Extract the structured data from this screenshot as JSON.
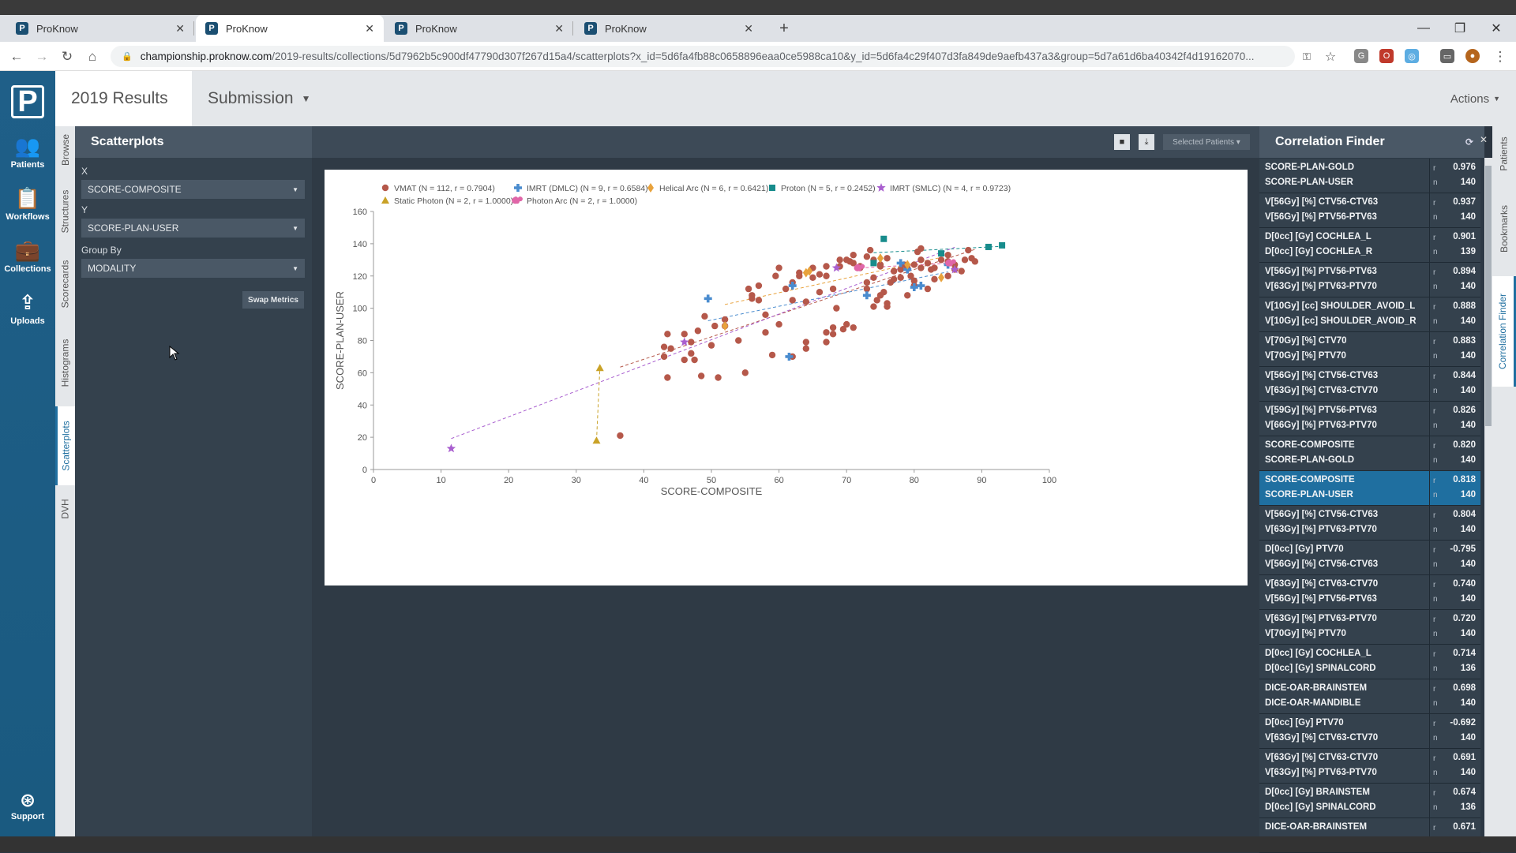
{
  "browser": {
    "tabs": [
      {
        "label": "ProKnow",
        "favicon": "P"
      },
      {
        "label": "ProKnow",
        "favicon": "P"
      },
      {
        "label": "ProKnow",
        "favicon": "P"
      },
      {
        "label": "ProKnow",
        "favicon": "P"
      }
    ],
    "url_host": "championship.proknow.com",
    "url_path": "/2019-results/collections/5d7962b5c900df47790d307f267d15a4/scatterplots?x_id=5d6fa4fb88c0658896eaa0ce5988ca10&y_id=5d6fa4c29f407d3fa849de9aefb437a3&group=5d7a61d6ba40342f4d19162070..."
  },
  "leftnav": {
    "logo": "P",
    "items": [
      {
        "label": "Patients",
        "icon": "users-icon"
      },
      {
        "label": "Workflows",
        "icon": "clipboard-check-icon"
      },
      {
        "label": "Collections",
        "icon": "briefcase-icon"
      },
      {
        "label": "Uploads",
        "icon": "upload-icon"
      }
    ],
    "support": "Support"
  },
  "header": {
    "title": "2019 Results",
    "subtitle": "Submission",
    "actions": "Actions"
  },
  "vtabs": [
    "Browse",
    "Structures",
    "Scorecards",
    "Histograms",
    "Scatterplots",
    "DVH"
  ],
  "panel": {
    "title": "Scatterplots",
    "x_label": "X",
    "x_value": "SCORE-COMPOSITE",
    "y_label": "Y",
    "y_value": "SCORE-PLAN-USER",
    "group_label": "Group By",
    "group_value": "MODALITY",
    "swap": "Swap Metrics"
  },
  "toolbar": {
    "selected_patients": "Selected Patients"
  },
  "chart_data": {
    "type": "scatter",
    "xlabel": "SCORE-COMPOSITE",
    "ylabel": "SCORE-PLAN-USER",
    "xlim": [
      0,
      100
    ],
    "ylim": [
      0,
      160
    ],
    "xticks": [
      0,
      10,
      20,
      30,
      40,
      50,
      60,
      70,
      80,
      90,
      100
    ],
    "yticks": [
      0,
      20,
      40,
      60,
      80,
      100,
      120,
      140,
      160
    ],
    "legend_placement": "top-left",
    "series": [
      {
        "name": "VMAT (N = 112, r = 0.7904)",
        "color": "#b5584a",
        "marker": "circle",
        "points": [
          [
            36.5,
            21
          ],
          [
            43.5,
            57
          ],
          [
            43,
            70
          ],
          [
            43,
            76
          ],
          [
            43.5,
            84
          ],
          [
            44,
            75
          ],
          [
            46,
            84
          ],
          [
            46,
            68
          ],
          [
            47,
            72
          ],
          [
            47,
            79
          ],
          [
            47.5,
            68
          ],
          [
            48,
            86
          ],
          [
            48.5,
            58
          ],
          [
            49,
            95
          ],
          [
            50,
            77
          ],
          [
            50.5,
            89
          ],
          [
            51,
            57
          ],
          [
            52,
            93
          ],
          [
            52,
            89
          ],
          [
            54,
            80
          ],
          [
            55,
            60
          ],
          [
            55.5,
            112
          ],
          [
            56,
            106
          ],
          [
            56,
            108
          ],
          [
            57,
            105
          ],
          [
            57,
            114
          ],
          [
            58,
            85
          ],
          [
            58,
            96
          ],
          [
            59,
            71
          ],
          [
            59.5,
            120
          ],
          [
            60,
            90
          ],
          [
            60,
            125
          ],
          [
            61,
            112
          ],
          [
            62,
            70
          ],
          [
            62,
            105
          ],
          [
            62,
            116
          ],
          [
            63,
            120
          ],
          [
            63,
            122
          ],
          [
            64,
            75
          ],
          [
            64,
            79
          ],
          [
            64,
            104
          ],
          [
            65,
            119
          ],
          [
            65,
            125
          ],
          [
            66,
            110
          ],
          [
            66,
            121
          ],
          [
            67,
            120
          ],
          [
            67,
            126
          ],
          [
            67,
            79
          ],
          [
            67,
            85
          ],
          [
            68,
            84
          ],
          [
            68,
            88
          ],
          [
            68,
            112
          ],
          [
            68.5,
            100
          ],
          [
            69,
            126
          ],
          [
            69,
            130
          ],
          [
            69.5,
            87
          ],
          [
            70,
            90
          ],
          [
            70,
            130
          ],
          [
            70.5,
            129
          ],
          [
            71,
            128
          ],
          [
            71,
            133
          ],
          [
            71,
            88
          ],
          [
            72,
            126
          ],
          [
            72,
            125
          ],
          [
            73,
            132
          ],
          [
            73,
            112
          ],
          [
            73,
            116
          ],
          [
            73.5,
            136
          ],
          [
            74,
            130
          ],
          [
            74,
            119
          ],
          [
            74,
            101
          ],
          [
            74.5,
            105
          ],
          [
            75,
            127
          ],
          [
            75,
            126
          ],
          [
            75,
            108
          ],
          [
            75.5,
            110
          ],
          [
            76,
            101
          ],
          [
            76,
            103
          ],
          [
            76,
            131
          ],
          [
            76.5,
            116
          ],
          [
            77,
            118
          ],
          [
            77,
            123
          ],
          [
            78,
            119
          ],
          [
            78,
            124
          ],
          [
            78.5,
            127
          ],
          [
            79,
            108
          ],
          [
            79,
            125
          ],
          [
            79.5,
            120
          ],
          [
            80,
            114
          ],
          [
            80,
            117
          ],
          [
            80,
            127
          ],
          [
            80.5,
            135
          ],
          [
            81,
            137
          ],
          [
            81,
            125
          ],
          [
            81,
            130
          ],
          [
            82,
            128
          ],
          [
            82,
            112
          ],
          [
            82.5,
            124
          ],
          [
            83,
            118
          ],
          [
            83,
            125
          ],
          [
            84,
            130
          ],
          [
            85,
            120
          ],
          [
            85,
            129
          ],
          [
            85,
            133
          ],
          [
            86,
            124
          ],
          [
            86,
            127
          ],
          [
            87,
            123
          ],
          [
            87.5,
            130
          ],
          [
            88,
            136
          ],
          [
            88.5,
            131
          ],
          [
            89,
            129
          ]
        ]
      },
      {
        "name": "IMRT (DMLC) (N = 9, r = 0.6584)",
        "color": "#4a8ccf",
        "marker": "plus",
        "points": [
          [
            49.5,
            106
          ],
          [
            61.5,
            70
          ],
          [
            62,
            114
          ],
          [
            73,
            108
          ],
          [
            78,
            128
          ],
          [
            79,
            124
          ],
          [
            80,
            113
          ],
          [
            81,
            114
          ],
          [
            85,
            127
          ]
        ]
      },
      {
        "name": "Helical Arc (N = 6, r = 0.6421)",
        "color": "#e8a23c",
        "marker": "diamond",
        "points": [
          [
            52,
            89
          ],
          [
            64,
            122
          ],
          [
            64.5,
            123
          ],
          [
            75,
            131
          ],
          [
            79,
            127
          ],
          [
            84,
            119
          ]
        ]
      },
      {
        "name": "Proton (N = 5, r = 0.2452)",
        "color": "#178c8c",
        "marker": "square",
        "points": [
          [
            75.5,
            143
          ],
          [
            74,
            128
          ],
          [
            84,
            134
          ],
          [
            91,
            138
          ],
          [
            93,
            139
          ]
        ]
      },
      {
        "name": "IMRT (SMLC) (N = 4, r = 0.9723)",
        "color": "#a95fcf",
        "marker": "star",
        "points": [
          [
            11.5,
            13
          ],
          [
            46,
            79
          ],
          [
            68.5,
            125
          ],
          [
            86,
            124
          ]
        ]
      },
      {
        "name": "Static Photon (N = 2, r = 1.0000)",
        "color": "#c9a227",
        "marker": "triangle",
        "points": [
          [
            33,
            18
          ],
          [
            33.5,
            63
          ]
        ]
      },
      {
        "name": "Photon Arc (N = 2, r = 1.0000)",
        "color": "#e066a8",
        "marker": "trefoil",
        "points": [
          [
            72,
            125
          ],
          [
            85.5,
            128
          ]
        ]
      }
    ]
  },
  "correlation_finder": {
    "title": "Correlation Finder",
    "rows": [
      {
        "m1": "SCORE-PLAN-GOLD",
        "m2": "SCORE-PLAN-USER",
        "r": "0.976",
        "n": "140"
      },
      {
        "m1": "V[56Gy] [%] CTV56-CTV63",
        "m2": "V[56Gy] [%] PTV56-PTV63",
        "r": "0.937",
        "n": "140"
      },
      {
        "m1": "D[0cc] [Gy] COCHLEA_L",
        "m2": "D[0cc] [Gy] COCHLEA_R",
        "r": "0.901",
        "n": "139"
      },
      {
        "m1": "V[56Gy] [%] PTV56-PTV63",
        "m2": "V[63Gy] [%] PTV63-PTV70",
        "r": "0.894",
        "n": "140"
      },
      {
        "m1": "V[10Gy] [cc] SHOULDER_AVOID_L",
        "m2": "V[10Gy] [cc] SHOULDER_AVOID_R",
        "r": "0.888",
        "n": "140"
      },
      {
        "m1": "V[70Gy] [%] CTV70",
        "m2": "V[70Gy] [%] PTV70",
        "r": "0.883",
        "n": "140"
      },
      {
        "m1": "V[56Gy] [%] CTV56-CTV63",
        "m2": "V[63Gy] [%] CTV63-CTV70",
        "r": "0.844",
        "n": "140"
      },
      {
        "m1": "V[59Gy] [%] PTV56-PTV63",
        "m2": "V[66Gy] [%] PTV63-PTV70",
        "r": "0.826",
        "n": "140"
      },
      {
        "m1": "SCORE-COMPOSITE",
        "m2": "SCORE-PLAN-GOLD",
        "r": "0.820",
        "n": "140"
      },
      {
        "m1": "SCORE-COMPOSITE",
        "m2": "SCORE-PLAN-USER",
        "r": "0.818",
        "n": "140",
        "selected": true
      },
      {
        "m1": "V[56Gy] [%] CTV56-CTV63",
        "m2": "V[63Gy] [%] PTV63-PTV70",
        "r": "0.804",
        "n": "140"
      },
      {
        "m1": "D[0cc] [Gy] PTV70",
        "m2": "V[56Gy] [%] CTV56-CTV63",
        "r": "-0.795",
        "n": "140"
      },
      {
        "m1": "V[63Gy] [%] CTV63-CTV70",
        "m2": "V[56Gy] [%] PTV56-PTV63",
        "r": "0.740",
        "n": "140"
      },
      {
        "m1": "V[63Gy] [%] PTV63-PTV70",
        "m2": "V[70Gy] [%] PTV70",
        "r": "0.720",
        "n": "140"
      },
      {
        "m1": "D[0cc] [Gy] COCHLEA_L",
        "m2": "D[0cc] [Gy] SPINALCORD",
        "r": "0.714",
        "n": "136"
      },
      {
        "m1": "DICE-OAR-BRAINSTEM",
        "m2": "DICE-OAR-MANDIBLE",
        "r": "0.698",
        "n": "140"
      },
      {
        "m1": "D[0cc] [Gy] PTV70",
        "m2": "V[63Gy] [%] CTV63-CTV70",
        "r": "-0.692",
        "n": "140"
      },
      {
        "m1": "V[63Gy] [%] CTV63-CTV70",
        "m2": "V[63Gy] [%] PTV63-PTV70",
        "r": "0.691",
        "n": "140"
      },
      {
        "m1": "D[0cc] [Gy] BRAINSTEM",
        "m2": "D[0cc] [Gy] SPINALCORD",
        "r": "0.674",
        "n": "136"
      },
      {
        "m1": "DICE-OAR-BRAINSTEM",
        "m2": "",
        "r": "0.671",
        "n": ""
      }
    ]
  },
  "rvtabs": [
    "Patients",
    "Bookmarks",
    "Correlation Finder"
  ]
}
